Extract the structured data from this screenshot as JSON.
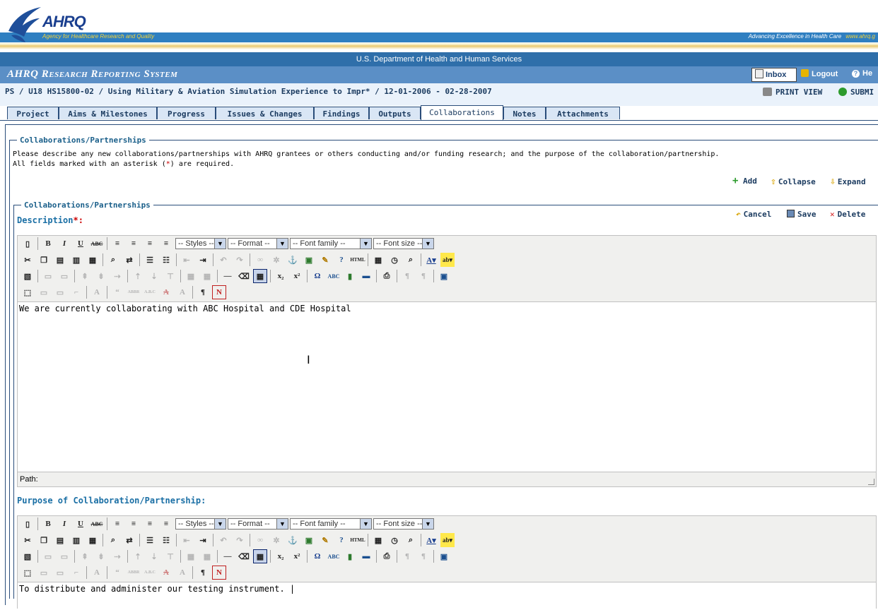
{
  "header": {
    "logo_text": "AHRQ",
    "agency_tagline": "Agency for Healthcare Research and Quality",
    "right_tagline": "Advancing Excellence in Health Care",
    "right_url": "www.ahrq.g",
    "department": "U.S. Department of Health and Human Services",
    "system_title": "AHRQ Research Reporting System",
    "inbox_label": "Inbox",
    "logout_label": "Logout",
    "help_label": "He"
  },
  "breadcrumb": {
    "path": "PS / U18 HS15800-02 / Using Military & Aviation Simulation Experience to Impr* / 12-01-2006 - 02-28-2007",
    "print_view": "PRINT VIEW",
    "submit": "SUBMI"
  },
  "tabs": [
    {
      "label": "Project"
    },
    {
      "label": "Aims & Milestones"
    },
    {
      "label": "Progress"
    },
    {
      "label": "Issues & Changes"
    },
    {
      "label": "Findings"
    },
    {
      "label": "Outputs"
    },
    {
      "label": "Collaborations",
      "active": true
    },
    {
      "label": "Notes"
    },
    {
      "label": "Attachments"
    }
  ],
  "section": {
    "legend": "Collaborations/Partnerships",
    "instruction_line1": "Please describe any new collaborations/partnerships with AHRQ grantees or others conducting and/or funding research; and the purpose of the collaboration/partnership.",
    "instruction_line2_pre": "All fields marked with an asterisk (",
    "asterisk": "*",
    "instruction_line2_post": ") are required.",
    "add_label": "Add",
    "collapse_label": "Collapse",
    "expand_label": "Expand"
  },
  "record": {
    "legend": "Collaborations/Partnerships",
    "cancel_label": "Cancel",
    "save_label": "Save",
    "delete_label": "Delete",
    "description_label": "Description",
    "description_required": "*:",
    "description_text": "We are currently collaborating with ABC Hospital and CDE Hospital",
    "path_label": "Path:",
    "purpose_label": "Purpose of Collaboration/Partnership:",
    "purpose_text": "To distribute  and administer our testing instrument. |"
  },
  "editor_toolbar": {
    "styles": "-- Styles --",
    "format": "-- Format --",
    "font_family": "-- Font family --",
    "font_size": "-- Font size --"
  },
  "colors": {
    "brand_blue": "#2f7fc1",
    "system_bar": "#5b8fc6",
    "label_blue": "#1a6fa5",
    "required_red": "#cc0000"
  }
}
